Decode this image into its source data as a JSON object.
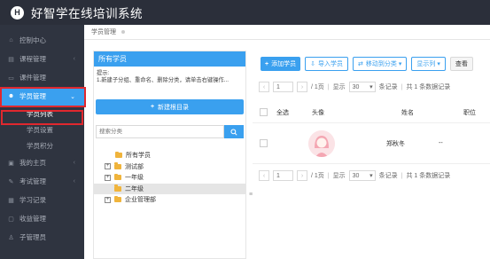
{
  "header": {
    "logo_letter": "H",
    "title": "好智学在线培训系统"
  },
  "sidebar": {
    "items": [
      {
        "label": "控制中心",
        "icon": "home-icon"
      },
      {
        "label": "课程管理",
        "icon": "course-icon"
      },
      {
        "label": "课件管理",
        "icon": "courseware-icon"
      },
      {
        "label": "学员管理",
        "icon": "user-group-icon",
        "active": true
      },
      {
        "label": "我的主页",
        "icon": "profile-icon"
      },
      {
        "label": "考试管理",
        "icon": "exam-icon"
      },
      {
        "label": "学习记录",
        "icon": "record-icon"
      },
      {
        "label": "收益管理",
        "icon": "revenue-icon"
      },
      {
        "label": "子管理员",
        "icon": "admin-icon"
      }
    ],
    "subitems": [
      "学员列表",
      "学员设置",
      "学员积分"
    ]
  },
  "breadcrumb": {
    "label": "学员管理"
  },
  "tree_panel": {
    "header": "所有学员",
    "tip_line1": "提示:",
    "tip_line2": "1.新建子分组、重命名、删除分类，请单击右键操作...",
    "new_root_label": "新建根目录",
    "search_placeholder": "搜索分类",
    "nodes": [
      {
        "label": "所有学员",
        "toggle": ""
      },
      {
        "label": "测试部",
        "toggle": "+"
      },
      {
        "label": "一年级",
        "toggle": "+"
      },
      {
        "label": "二年级",
        "toggle": "",
        "selected": true
      },
      {
        "label": "企业管理部",
        "toggle": "+"
      }
    ]
  },
  "toolbar": {
    "add_student": "添加学员",
    "import_student": "导入学员",
    "move_category": "移动到分类",
    "show_columns": "显示列",
    "view": "查看"
  },
  "pager": {
    "page_value": "1",
    "total_pages": "/ 1页",
    "show_label": "显示",
    "page_size": "30",
    "per_page_label": "条记录",
    "total_label": "共 1 条数据记录"
  },
  "table": {
    "columns": [
      "全选",
      "头像",
      "姓名",
      "职位"
    ],
    "rows": [
      {
        "name": "郑秋冬",
        "position": "--"
      }
    ]
  },
  "colors": {
    "accent": "#3aa0ef",
    "sidebar_bg": "#2f3440",
    "topbar_bg": "#2b2f3a",
    "highlight": "#e0282e"
  }
}
